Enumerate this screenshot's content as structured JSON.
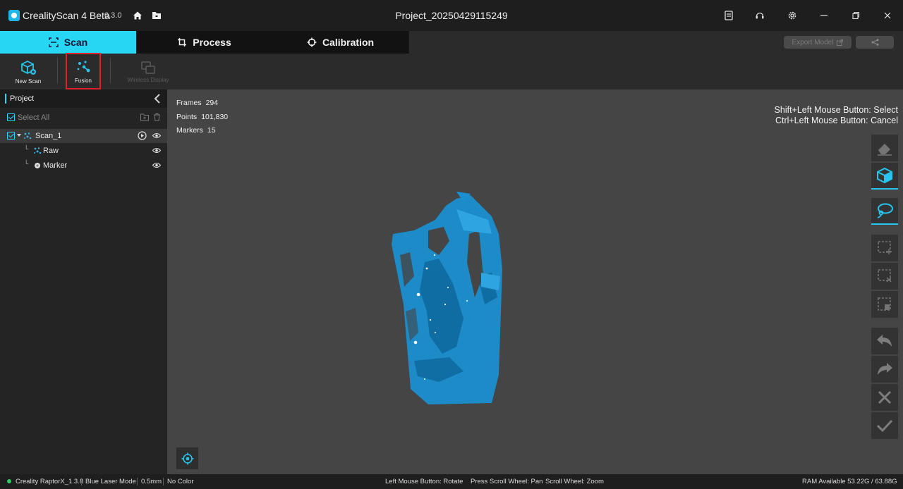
{
  "app": {
    "name": "CrealityScan 4 Beta",
    "version": "0.3.0",
    "project_title": "Project_20250429115249",
    "accent_color": "#27d6f3",
    "scan_color": "#1a8fd0"
  },
  "tabs": [
    {
      "label": "Scan",
      "icon": "scan-frame-icon",
      "active": true
    },
    {
      "label": "Process",
      "icon": "crop-icon",
      "active": false
    },
    {
      "label": "Calibration",
      "icon": "crosshair-icon",
      "active": false
    }
  ],
  "header_actions": {
    "export_label": "Export Model",
    "share_icon": "share-icon"
  },
  "toolbar": {
    "new_scan": "New Scan",
    "fusion": "Fusion",
    "wireless_display": "Wireless Display"
  },
  "project_panel": {
    "title": "Project",
    "select_all": "Select All",
    "items": [
      {
        "label": "Scan_1",
        "icon": "scan-icon",
        "checked": true
      },
      {
        "label": "Raw",
        "icon": "point-cloud-icon"
      },
      {
        "label": "Marker",
        "icon": "marker-dot-icon"
      }
    ]
  },
  "stats": {
    "frames_label": "Frames",
    "frames_value": "294",
    "points_label": "Points",
    "points_value": "101,830",
    "markers_label": "Markers",
    "markers_value": "15"
  },
  "hints": {
    "line1": "Shift+Left Mouse Button: Select",
    "line2": "Ctrl+Left Mouse Button: Cancel"
  },
  "statusbar": {
    "device": "Creality RaptorX_1.3.8",
    "mode": "Blue Laser Mode",
    "resolution": "0.5mm",
    "color": "No Color",
    "rotate": "Left Mouse Button: Rotate",
    "pan": "Press Scroll Wheel: Pan",
    "zoom": "Scroll Wheel: Zoom",
    "ram": "RAM Available 53.22G / 63.88G"
  }
}
